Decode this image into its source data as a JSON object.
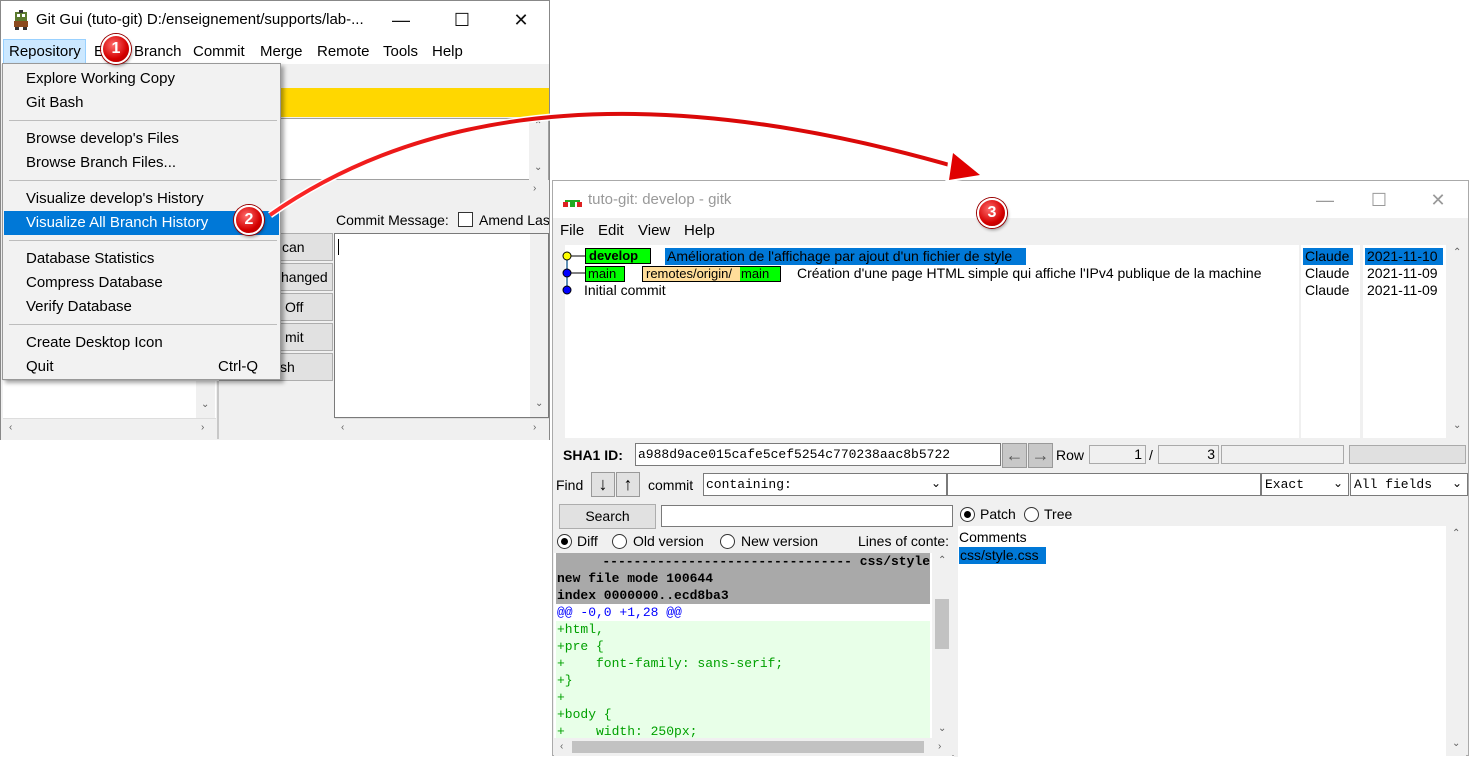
{
  "gitgui": {
    "title": "Git Gui (tuto-git) D:/enseignement/supports/lab-...",
    "menus": [
      "Repository",
      "Edit",
      "Branch",
      "Commit",
      "Merge",
      "Remote",
      "Tools",
      "Help"
    ],
    "commit_message_label": "Commit Message:",
    "amend_label": "Amend Las",
    "buttons": [
      "Rescan",
      "Stage Changed",
      "Sign Off",
      "Commit",
      "Push"
    ],
    "buttons_visible": [
      "can",
      "hanged",
      "Off",
      "mit",
      "sh"
    ]
  },
  "repo_menu": {
    "items": [
      {
        "label": "Explore Working Copy",
        "shortcut": ""
      },
      {
        "label": "Git Bash",
        "shortcut": ""
      },
      {
        "label": "Browse develop's Files",
        "shortcut": ""
      },
      {
        "label": "Browse Branch Files...",
        "shortcut": ""
      },
      {
        "label": "Visualize develop's History",
        "shortcut": ""
      },
      {
        "label": "Visualize All Branch History",
        "shortcut": ""
      },
      {
        "label": "Database Statistics",
        "shortcut": ""
      },
      {
        "label": "Compress Database",
        "shortcut": ""
      },
      {
        "label": "Verify Database",
        "shortcut": ""
      },
      {
        "label": "Create Desktop Icon",
        "shortcut": ""
      },
      {
        "label": "Quit",
        "shortcut": "Ctrl-Q"
      }
    ],
    "selected_index": 5
  },
  "badges": [
    "1",
    "2",
    "3"
  ],
  "gitk": {
    "title": "tuto-git: develop - gitk",
    "menus": [
      "File",
      "Edit",
      "View",
      "Help"
    ],
    "commits": [
      {
        "refs": [
          {
            "label": "develop",
            "kind": "head"
          }
        ],
        "message": "Amélioration de l'affichage par ajout d'un fichier de style",
        "author": "Claude",
        "date": "2021-11-10",
        "selected": true
      },
      {
        "refs": [
          {
            "label": "main",
            "kind": "branch"
          },
          {
            "label": "remotes/origin/",
            "kind": "remote"
          },
          {
            "label": "main",
            "kind": "branch"
          }
        ],
        "message": "Création d'une page HTML simple qui affiche l'IPv4 publique de la machine",
        "author": "Claude",
        "date": "2021-11-09",
        "selected": false
      },
      {
        "refs": [],
        "message": "Initial commit",
        "author": "Claude",
        "date": "2021-11-09",
        "selected": false
      }
    ],
    "sha1_label": "SHA1 ID:",
    "sha1_value": "a988d9ace015cafe5cef5254c770238aac8b5722",
    "row_label": "Row",
    "row_current": "1",
    "row_sep": "/",
    "row_total": "3",
    "find_label": "Find",
    "find_type": "commit",
    "find_containing": "containing:",
    "find_exact": "Exact",
    "find_fields": "All fields",
    "search_button": "Search",
    "patch_label": "Patch",
    "tree_label": "Tree",
    "diff_label": "Diff",
    "old_version_label": "Old version",
    "new_version_label": "New version",
    "lines_of_context_label": "Lines of conte:",
    "diff_lines": [
      {
        "text": "-------------------------------- css/style",
        "kind": "header"
      },
      {
        "text": "new file mode 100644",
        "kind": "header"
      },
      {
        "text": "index 0000000..ecd8ba3",
        "kind": "header"
      },
      {
        "text": "@@ -0,0 +1,28 @@",
        "kind": "hunk"
      },
      {
        "text": "+html,",
        "kind": "add"
      },
      {
        "text": "+pre {",
        "kind": "add"
      },
      {
        "text": "+    font-family: sans-serif;",
        "kind": "add"
      },
      {
        "text": "+}",
        "kind": "add"
      },
      {
        "text": "+",
        "kind": "add"
      },
      {
        "text": "+body {",
        "kind": "add"
      },
      {
        "text": "+    width: 250px;",
        "kind": "add"
      }
    ],
    "file_list": [
      {
        "label": "Comments",
        "selected": false
      },
      {
        "label": "css/style.css",
        "selected": true
      }
    ]
  },
  "colors": {
    "menu_highlight": "#0078d7",
    "staged_bar": "#ffd700",
    "head_ref": "#00ff00",
    "remote_ref": "#ffdd99",
    "diff_header_bg": "#a9a9a9",
    "diff_add_fg": "#00a000",
    "diff_add_bg": "#e8ffe8",
    "hunk_fg": "#0000ff",
    "arrow": "#ee0000"
  }
}
